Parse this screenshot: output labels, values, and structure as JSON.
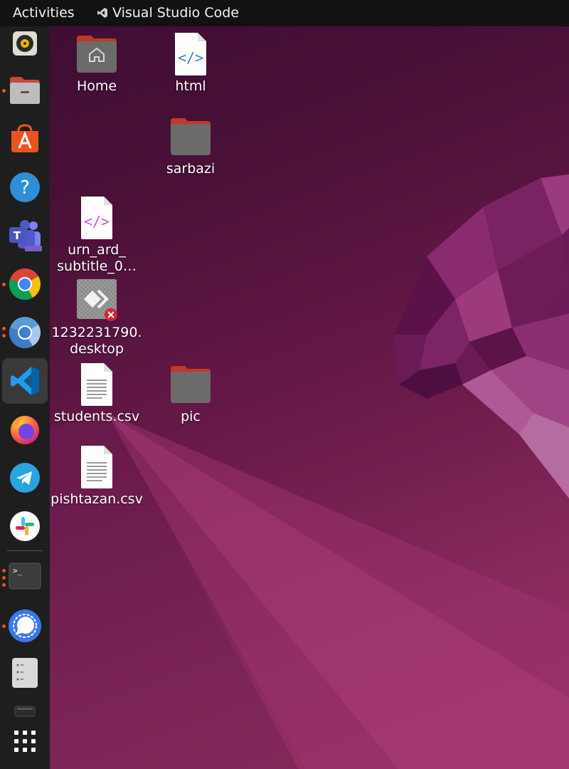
{
  "topbar": {
    "activities": "Activities",
    "app_name": "Visual Studio Code"
  },
  "dock": {
    "items": [
      {
        "name": "rhythmbox",
        "icon": "speaker-icon",
        "running": false
      },
      {
        "name": "files",
        "icon": "file-cabinet-icon",
        "running": true
      },
      {
        "name": "software",
        "icon": "app-store-icon",
        "running": false
      },
      {
        "name": "help",
        "icon": "help-icon",
        "running": false
      },
      {
        "name": "teams",
        "icon": "teams-icon",
        "running": false
      },
      {
        "name": "chrome",
        "icon": "chrome-icon",
        "running": true
      },
      {
        "name": "chromium",
        "icon": "chromium-icon",
        "running": true
      },
      {
        "name": "vscode",
        "icon": "vscode-icon",
        "running": true
      },
      {
        "name": "firefox",
        "icon": "firefox-icon",
        "running": false
      },
      {
        "name": "telegram",
        "icon": "telegram-icon",
        "running": false
      },
      {
        "name": "slack",
        "icon": "slack-icon",
        "running": false
      },
      {
        "name": "terminal",
        "icon": "terminal-icon",
        "running": true
      },
      {
        "name": "signal",
        "icon": "signal-icon",
        "running": true
      },
      {
        "name": "disks",
        "icon": "disks-icon",
        "running": false
      },
      {
        "name": "drive",
        "icon": "drive-icon",
        "running": false
      },
      {
        "name": "show-apps",
        "icon": "app-grid-icon",
        "running": false
      }
    ]
  },
  "desktop": {
    "home": "Home",
    "html": "html",
    "sarbazi": "sarbazi",
    "urn_line1": "urn_ard_",
    "urn_line2": "subtitle_0…",
    "desktop_line1": "1232231790.",
    "desktop_line2": "desktop",
    "students": "students.csv",
    "pic": "pic",
    "pishtazan": "pishtazan.csv"
  },
  "colors": {
    "accent": "#e95420",
    "folder": "#6b6b6b",
    "folder_tab": "#c0392b"
  }
}
